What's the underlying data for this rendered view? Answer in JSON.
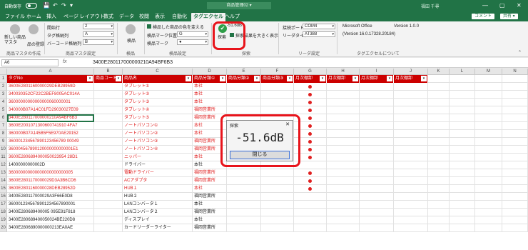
{
  "titlebar": {
    "autosave": "自動保存",
    "toggle": "オフ",
    "filename": "商品管理02 ▾",
    "user": "福田 千尋",
    "min": "—",
    "max": "▢",
    "close": "✕"
  },
  "tabs": [
    "ファイル",
    "ホーム",
    "挿入",
    "ページ レイアウト",
    "数式",
    "データ",
    "校閲",
    "表示",
    "自動化",
    "タグエクセル",
    "ヘルプ"
  ],
  "active_tab": "タグエクセル",
  "comment_btn": "コメント",
  "share_btn": "共有 ▾",
  "ribbon": {
    "new_label": "新しい商品マスタ",
    "new_label2": "",
    "item_register": "品の登録",
    "grp_master": "商品マスタの作成",
    "start_row_label": "開始行",
    "start_row_val": "2",
    "tag_col_label": "タグ格納列",
    "tag_col_val": "A",
    "barcode_col_label": "バーコード格納列",
    "barcode_col_val": "B",
    "grp_master_settings": "商品マスタ設定",
    "btn_goods": "検品",
    "grp_goods": "検品",
    "chk_color": "検品した商品の色を変える",
    "mark_pos_label": "検品マーク位置",
    "mark_pos_val": "G",
    "mark_label": "検品マーク",
    "mark_val": "●",
    "grp_goods_settings": "検品設定",
    "signal_value": "-51.6dB",
    "btn_search": "探索",
    "chk_fullscreen": "探索結果を大きく表示",
    "grp_search": "探索",
    "port_label": "接続ポート",
    "port_val": "COM4",
    "reader_label": "リーダタイプ",
    "reader_val": "AT388",
    "grp_reader": "リーダ設定",
    "about_line1": "Microsoft Office",
    "about_ver": "Version 1.0.0",
    "about_line2": "(Version 16.0.17328.20184)",
    "grp_about": "タグエクセルについて"
  },
  "namebox": "A6",
  "fx": "fx",
  "formula": "3400E280117000000210A94BF6B3",
  "columns": [
    "A",
    "B",
    "C",
    "D",
    "E",
    "F",
    "G",
    "H",
    "I",
    "J",
    "K",
    "L",
    "M",
    "N"
  ],
  "headers": [
    "タグNo",
    "商品コード",
    "商品名",
    "商品分類①",
    "商品分類②",
    "商品分類③",
    "月次棚卸",
    "月次棚卸",
    "月次棚卸",
    "月次棚卸"
  ],
  "rows": [
    {
      "n": "2",
      "tag": "3600E2801160000029DEB28959D",
      "name": "タブレット①",
      "cat": "本社",
      "red": true,
      "dot": true
    },
    {
      "n": "3",
      "tag": "340030352CF22C2BEF8005AC014A",
      "name": "タブレット②",
      "cat": "本社",
      "red": true,
      "dot": true
    },
    {
      "n": "4",
      "tag": "36000000000000000060000001",
      "name": "タブレット③",
      "cat": "本社",
      "red": true,
      "dot": true
    },
    {
      "n": "5",
      "tag": "340000B07A14C01FD29030027E09",
      "name": "タブレット④",
      "cat": "福岡営業所",
      "red": true,
      "dot": true
    },
    {
      "n": "6",
      "tag": "3400E280117000000210A94BF6B3",
      "name": "タブレット⑤",
      "cat": "福岡営業所",
      "red": true,
      "dot": true
    },
    {
      "n": "7",
      "tag": "3600E2001071300600741910 4FA7",
      "name": "ノートパソコン①",
      "cat": "本社",
      "red": true,
      "dot": true
    },
    {
      "n": "8",
      "tag": "360000B07A145B5F5E970AE29152",
      "name": "ノートパソコン②",
      "cat": "本社",
      "red": true,
      "dot": true
    },
    {
      "n": "9",
      "tag": "360001234567890123456789 00049",
      "name": "ノートパソコン③",
      "cat": "福岡営業所",
      "red": true,
      "dot": true
    },
    {
      "n": "10",
      "tag": "360004567890120000000000001E1",
      "name": "ノートパソコン④",
      "cat": "福岡営業所",
      "red": true,
      "dot": true
    },
    {
      "n": "11",
      "tag": "3600E2806894000050023954 28D1",
      "name": "ニッパー",
      "cat": "本社",
      "red": true,
      "dot": true
    },
    {
      "n": "12",
      "tag": "14000000000002D",
      "name": "ドライバー",
      "cat": "本社",
      "red": false,
      "dot": false
    },
    {
      "n": "13",
      "tag": "360000000000000000000000005",
      "name": "電動ドライバー",
      "cat": "福岡営業所",
      "red": true,
      "dot": true
    },
    {
      "n": "14",
      "tag": "3600E2801170000029D3A3B6CD6",
      "name": "ACアダプタ",
      "cat": "福岡営業所",
      "red": true,
      "dot": true
    },
    {
      "n": "15",
      "tag": "3600E2801160000028DEB28952D",
      "name": "HUB１",
      "cat": "本社",
      "red": true,
      "dot": true
    },
    {
      "n": "16",
      "tag": "3400E280117000029A3F66E0D8",
      "name": "HUB２",
      "cat": "福岡営業所",
      "red": false,
      "dot": false
    },
    {
      "n": "17",
      "tag": "3600012345678901234567890001",
      "name": "LANコンバータ１",
      "cat": "本社",
      "red": false,
      "dot": false
    },
    {
      "n": "18",
      "tag": "3400E280689400005 095E91F818",
      "name": "LANコンバータ２",
      "cat": "福岡営業所",
      "red": false,
      "dot": false
    },
    {
      "n": "19",
      "tag": "3400E280689400050024BE220D8",
      "name": "ディスプレイ",
      "cat": "本社",
      "red": false,
      "dot": false
    },
    {
      "n": "20",
      "tag": "3400E2806890000000213EA0AE",
      "name": "カードリーダーライター",
      "cat": "福岡営業所",
      "red": false,
      "dot": false
    }
  ],
  "dialog": {
    "title": "探索",
    "close": "✕",
    "value": "-51.6dB",
    "button": "閉じる"
  }
}
